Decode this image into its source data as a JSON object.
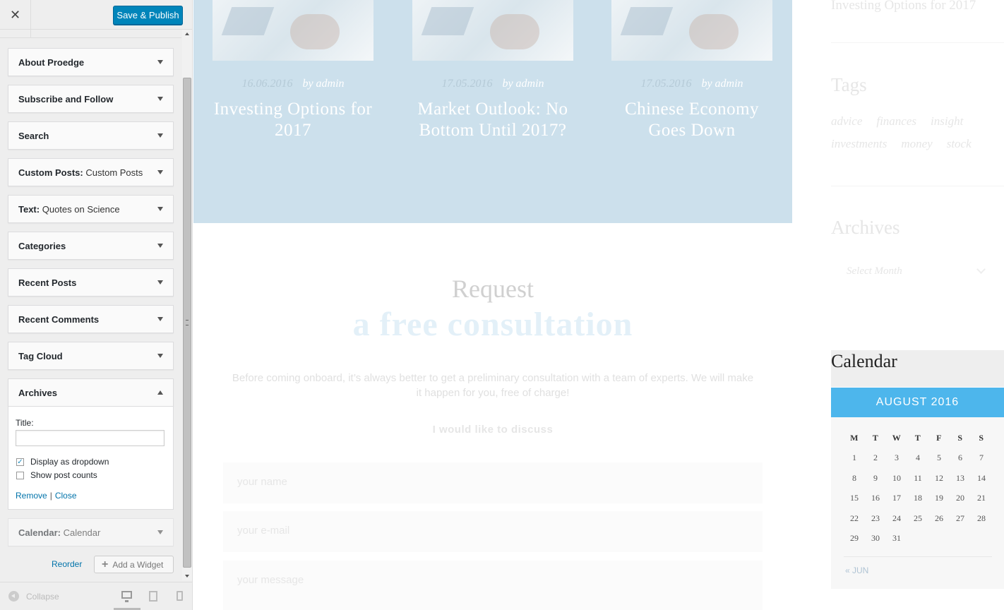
{
  "customizer": {
    "close_icon": "close-icon",
    "save_label": "Save & Publish",
    "widgets": [
      {
        "title": "About Proedge",
        "subtitle": ""
      },
      {
        "title": "Subscribe and Follow",
        "subtitle": ""
      },
      {
        "title": "Search",
        "subtitle": ""
      },
      {
        "title": "Custom Posts:",
        "subtitle": "Custom Posts"
      },
      {
        "title": "Text:",
        "subtitle": "Quotes on Science"
      },
      {
        "title": "Categories",
        "subtitle": ""
      },
      {
        "title": "Recent Posts",
        "subtitle": ""
      },
      {
        "title": "Recent Comments",
        "subtitle": ""
      },
      {
        "title": "Tag Cloud",
        "subtitle": ""
      }
    ],
    "archives": {
      "title": "Archives",
      "title_label": "Title:",
      "title_value": "",
      "display_dropdown_label": "Display as dropdown",
      "display_dropdown_checked": true,
      "show_counts_label": "Show post counts",
      "show_counts_checked": false,
      "remove_label": "Remove",
      "separator": "|",
      "close_label": "Close"
    },
    "calendar_widget": {
      "title": "Calendar:",
      "subtitle": "Calendar"
    },
    "reorder_label": "Reorder",
    "add_widget_label": "Add a Widget",
    "collapse_label": "Collapse",
    "active_device": "desktop"
  },
  "preview": {
    "posts": [
      {
        "date": "16.06.2016",
        "author": "by admin",
        "title": "Investing Options for 2017"
      },
      {
        "date": "17.05.2016",
        "author": "by admin",
        "title": "Market Outlook: No Bottom Until 2017?"
      },
      {
        "date": "17.05.2016",
        "author": "by admin",
        "title": "Chinese Economy Goes Down"
      }
    ],
    "request": {
      "line1": "Request",
      "line2": "a free consultation",
      "description": "Before coming onboard, it’s always better to get a preliminary consultation with a team of experts. We will make it happen for you, free of charge!",
      "discuss_label": "I would like to discuss",
      "name_placeholder": "your name",
      "email_placeholder": "your e-mail",
      "message_placeholder": "your message"
    },
    "sidebar": {
      "recent_post_title": "Investing Options for 2017",
      "tags_heading": "Tags",
      "tags": [
        "advice",
        "finances",
        "insight",
        "investments",
        "money",
        "stock"
      ],
      "archives_heading": "Archives",
      "month_placeholder": "Select Month",
      "calendar_heading": "Calendar",
      "calendar_month": "AUGUST 2016",
      "weekdays": [
        "M",
        "T",
        "W",
        "T",
        "F",
        "S",
        "S"
      ],
      "weeks": [
        [
          "1",
          "2",
          "3",
          "4",
          "5",
          "6",
          "7"
        ],
        [
          "8",
          "9",
          "10",
          "11",
          "12",
          "13",
          "14"
        ],
        [
          "15",
          "16",
          "17",
          "18",
          "19",
          "20",
          "21"
        ],
        [
          "22",
          "23",
          "24",
          "25",
          "26",
          "27",
          "28"
        ],
        [
          "29",
          "30",
          "31",
          "",
          "",
          "",
          ""
        ]
      ],
      "prev_link": "« JUN"
    }
  },
  "colors": {
    "primary_button": "#0085ba",
    "posts_band": "#cce0ec",
    "calendar_accent": "#4db6ec"
  }
}
